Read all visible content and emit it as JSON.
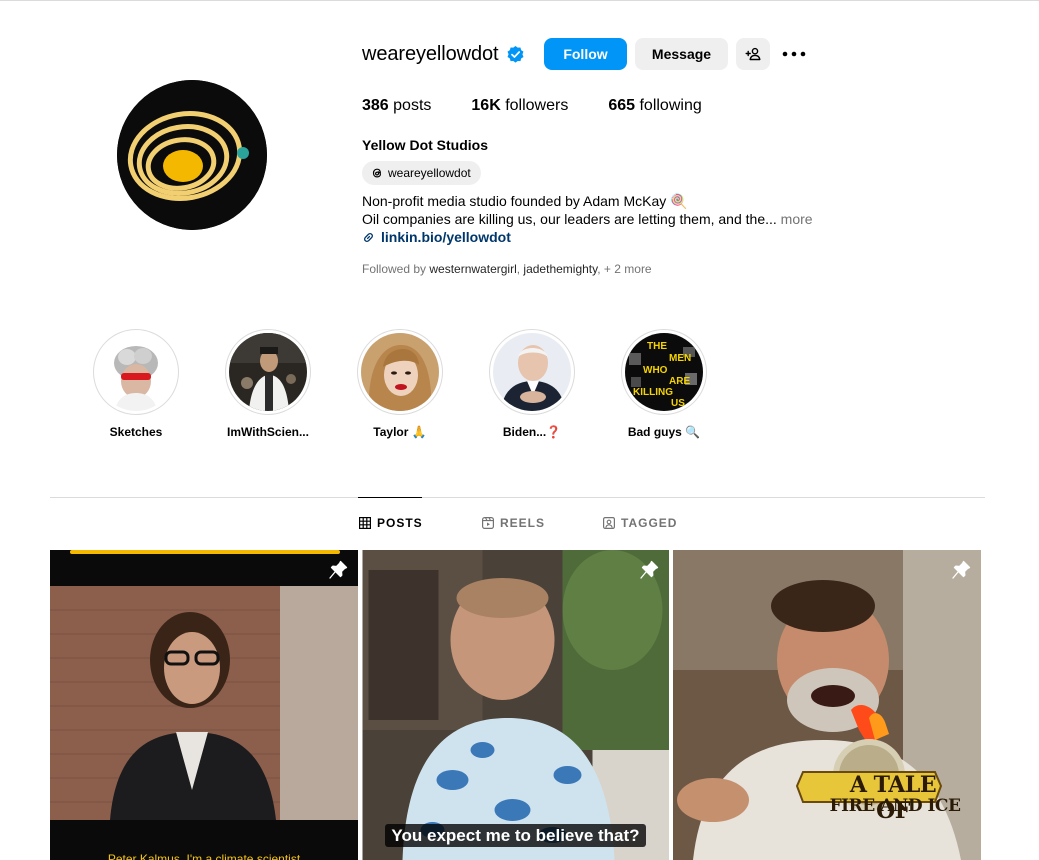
{
  "profile": {
    "username": "weareyellowdot",
    "verified": true,
    "follow_label": "Follow",
    "message_label": "Message",
    "display_name": "Yellow Dot Studios",
    "threads_handle": "weareyellowdot",
    "bio_line1": "Non-profit media studio founded by Adam McKay 🍭",
    "bio_line2": "Oil companies are killing us, our leaders are letting them, and the...",
    "bio_more": "more",
    "link": "linkin.bio/yellowdot",
    "followed_by_prefix": "Followed by",
    "followed_by_1": "westernwatergirl",
    "followed_by_sep": ", ",
    "followed_by_2": "jadethemighty",
    "followed_by_suffix": ", + 2 more"
  },
  "stats": {
    "posts_count": "386",
    "posts_label": " posts",
    "followers_count": "16K",
    "followers_label": " followers",
    "following_count": "665",
    "following_label": " following"
  },
  "highlights": [
    {
      "label": "Sketches"
    },
    {
      "label": "ImWithScien..."
    },
    {
      "label": "Taylor 🙏"
    },
    {
      "label": "Biden...❓"
    },
    {
      "label": "Bad guys 🔍"
    }
  ],
  "highlight_art_text": [
    "THE",
    "MEN",
    "WHO",
    "ARE",
    "KILLING",
    "US"
  ],
  "tabs": [
    {
      "label": "POSTS",
      "icon": "grid-icon",
      "active": true
    },
    {
      "label": "REELS",
      "icon": "reels-icon",
      "active": false
    },
    {
      "label": "TAGGED",
      "icon": "tagged-icon",
      "active": false
    }
  ],
  "posts": [
    {
      "caption": "Peter Kalmus, I'm a climate scientist",
      "pinned": true
    },
    {
      "caption": "You expect me to believe that?",
      "pinned": true
    },
    {
      "caption_line1": "A TALE OF",
      "caption_line2": "FIRE AND ICE",
      "pinned": true
    }
  ],
  "colors": {
    "accent": "#0095f6",
    "secondary_button": "#efefef",
    "link": "#00376b",
    "muted": "#737373",
    "brand_yellow": "#f5b800"
  }
}
